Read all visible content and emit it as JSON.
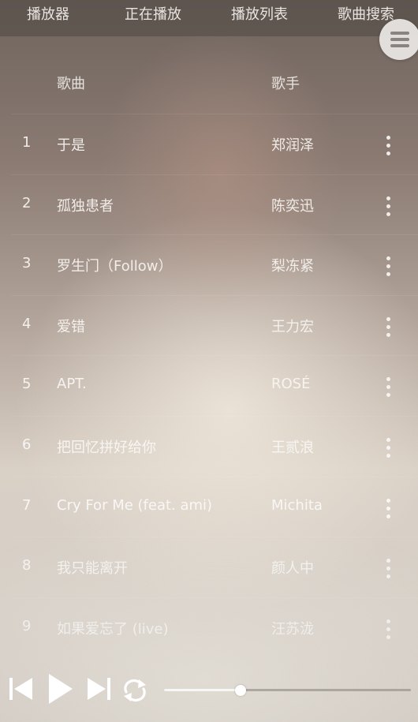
{
  "tabs": [
    {
      "label": "播放器"
    },
    {
      "label": "正在播放"
    },
    {
      "label": "播放列表"
    },
    {
      "label": "歌曲搜索"
    }
  ],
  "table": {
    "headers": {
      "song": "歌曲",
      "artist": "歌手"
    },
    "rows": [
      {
        "num": "1",
        "song": "于是",
        "artist": "郑润泽"
      },
      {
        "num": "2",
        "song": "孤独患者",
        "artist": "陈奕迅"
      },
      {
        "num": "3",
        "song": "罗生门（Follow）",
        "artist": "梨冻紧"
      },
      {
        "num": "4",
        "song": "爱错",
        "artist": "王力宏"
      },
      {
        "num": "5",
        "song": "APT.",
        "artist": "ROSÉ"
      },
      {
        "num": "6",
        "song": "把回忆拼好给你",
        "artist": "王贰浪"
      },
      {
        "num": "7",
        "song": "Cry For Me (feat. ami)",
        "artist": "Michita"
      },
      {
        "num": "8",
        "song": "我只能离开",
        "artist": "颜人中"
      },
      {
        "num": "9",
        "song": "如果爱忘了 (live)",
        "artist": "汪苏泷"
      }
    ]
  },
  "player": {
    "progress_fraction": 0.31,
    "icons": [
      "previous-icon",
      "play-icon",
      "next-icon",
      "repeat-icon"
    ]
  },
  "colors": {
    "text": "#f2f2f2",
    "knob": "#ffffff"
  }
}
